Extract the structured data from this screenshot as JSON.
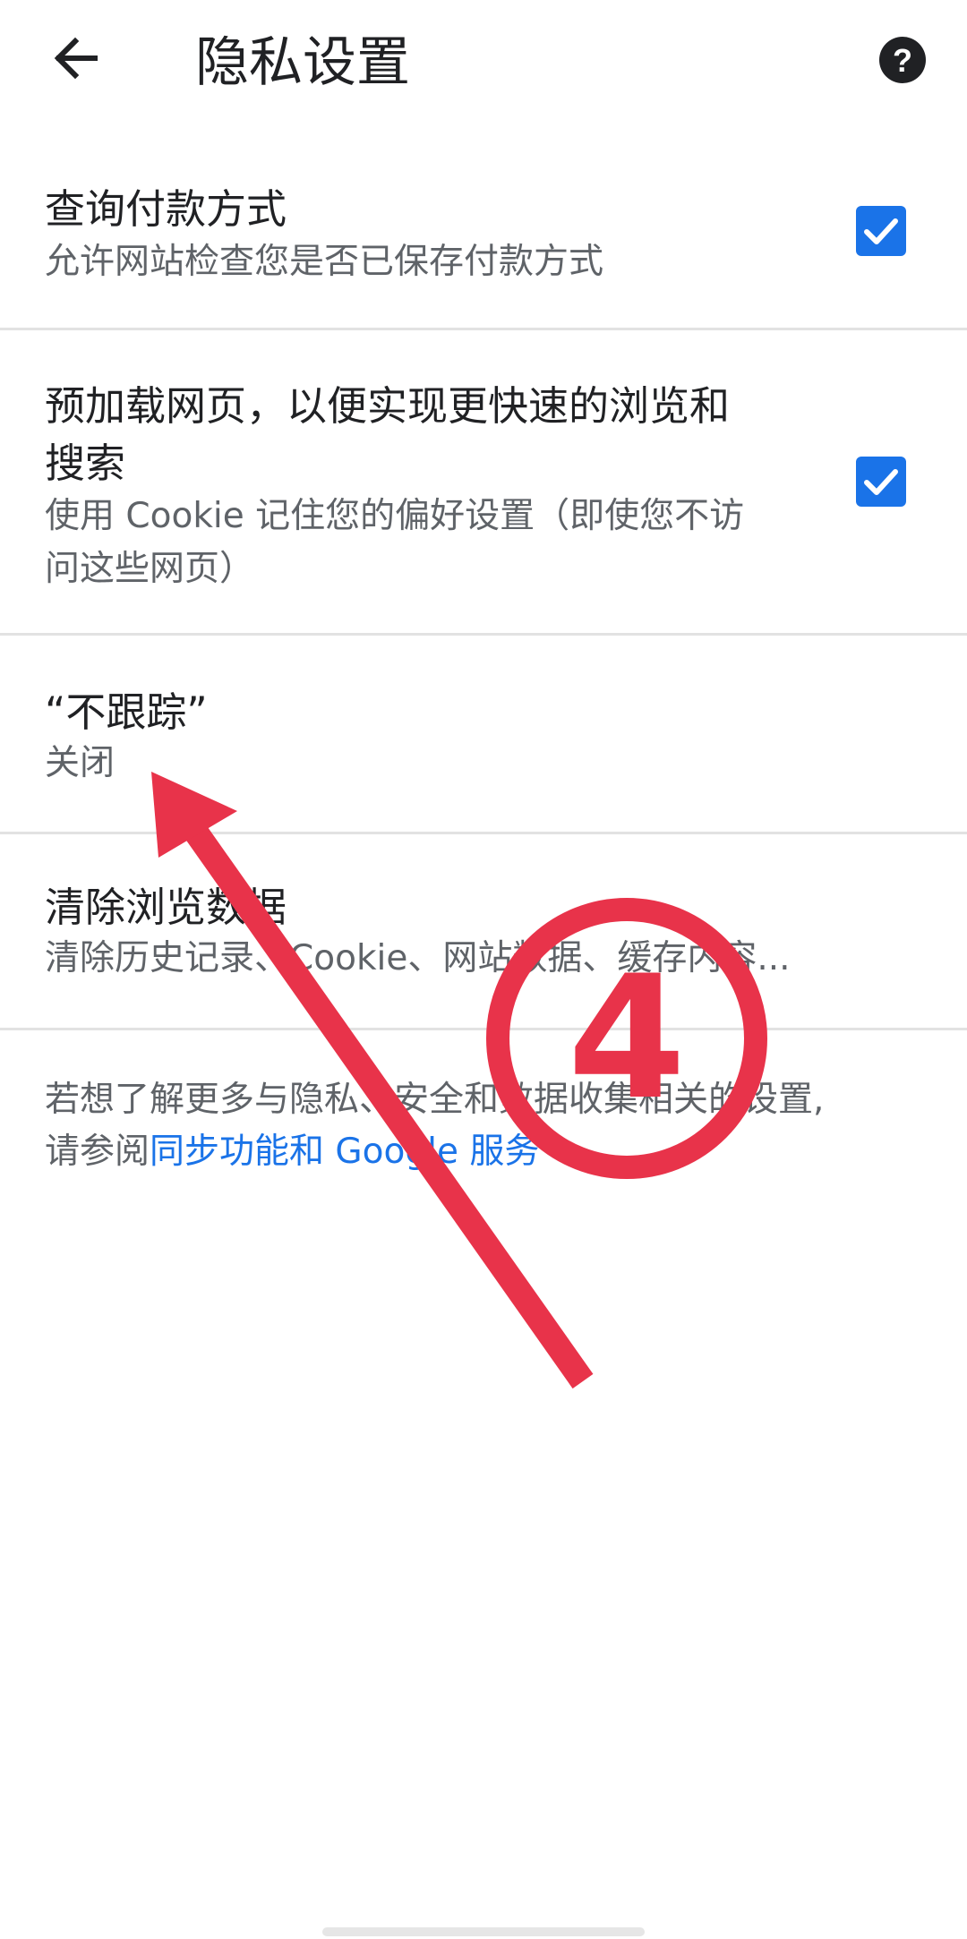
{
  "header": {
    "title": "隐私设置",
    "back_icon": "arrow-left-icon",
    "help_icon": "help-circle-icon"
  },
  "settings": [
    {
      "title": "查询付款方式",
      "summary": "允许网站检查您是否已保存付款方式",
      "checked": true
    },
    {
      "title_line1": "预加载网页，以便实现更快速的浏览和",
      "title_line2": "搜索",
      "summary_line1": "使用 Cookie 记住您的偏好设置（即使您不访",
      "summary_line2": "问这些网页）",
      "checked": true
    },
    {
      "title": "“不跟踪”",
      "summary": "关闭"
    },
    {
      "title": "清除浏览数据",
      "summary": "清除历史记录、Cookie、网站数据、缓存内容..."
    }
  ],
  "footer": {
    "line1": "若想了解更多与隐私、安全和数据收集相关的设置,",
    "line2_prefix": "请参阅",
    "link": "同步功能和 Google 服务"
  },
  "annotation": {
    "step_number": "4",
    "color": "#e8334a"
  },
  "colors": {
    "accent": "#1a73e8",
    "text_primary": "#202124",
    "text_secondary": "#5f6368",
    "divider": "#e2e2e2"
  }
}
